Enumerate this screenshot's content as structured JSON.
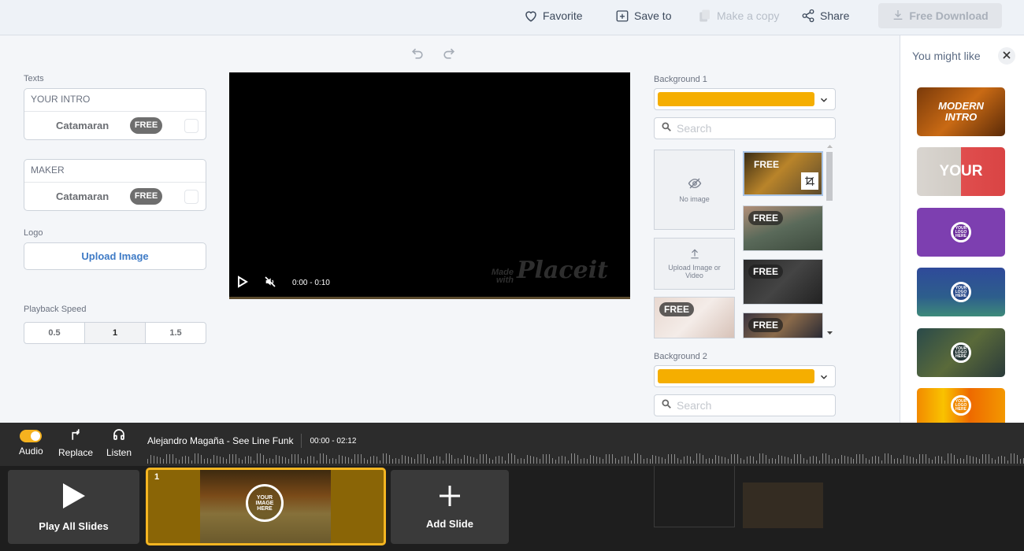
{
  "topbar": {
    "favorite": "Favorite",
    "save_to": "Save to",
    "make_copy": "Make a copy",
    "share": "Share",
    "free_download": "Free Download"
  },
  "editor": {
    "texts_label": "Texts",
    "text_fields": [
      {
        "value": "YOUR INTRO",
        "font": "Catamaran",
        "badge": "FREE"
      },
      {
        "value": "MAKER",
        "font": "Catamaran",
        "badge": "FREE"
      }
    ],
    "logo_label": "Logo",
    "upload_image": "Upload Image",
    "playback_label": "Playback Speed",
    "speeds": [
      "0.5",
      "1",
      "1.5"
    ],
    "active_speed": "1"
  },
  "player": {
    "time": "0:00 - 0:10",
    "watermark_small": "Made with",
    "watermark_big": "Placeit"
  },
  "backgrounds": {
    "bg1_label": "Background 1",
    "bg2_label": "Background 2",
    "color": "#f5ae00",
    "search_placeholder": "Search",
    "no_image": "No image",
    "upload_media": "Upload Image or Video",
    "free_tag": "FREE"
  },
  "sidebar": {
    "title": "You might like",
    "items": [
      {
        "title": "MODERN INTRO"
      },
      {
        "title": "YOUR"
      },
      {
        "title": "YOUR LOGO HERE"
      },
      {
        "title": "YOUR LOGO HERE"
      },
      {
        "title": "YOUR LOGO HERE"
      },
      {
        "title": "YOUR LOGO HERE"
      }
    ]
  },
  "timeline": {
    "audio": "Audio",
    "replace": "Replace",
    "listen": "Listen",
    "track_name": "Alejandro Magaña - See Line Funk",
    "track_time": "00:00 - 02:12",
    "play_all": "Play All Slides",
    "slide_number": "1",
    "slide_text": "YOUR IMAGE HERE",
    "add_slide": "Add Slide",
    "audio_enabled": true
  }
}
